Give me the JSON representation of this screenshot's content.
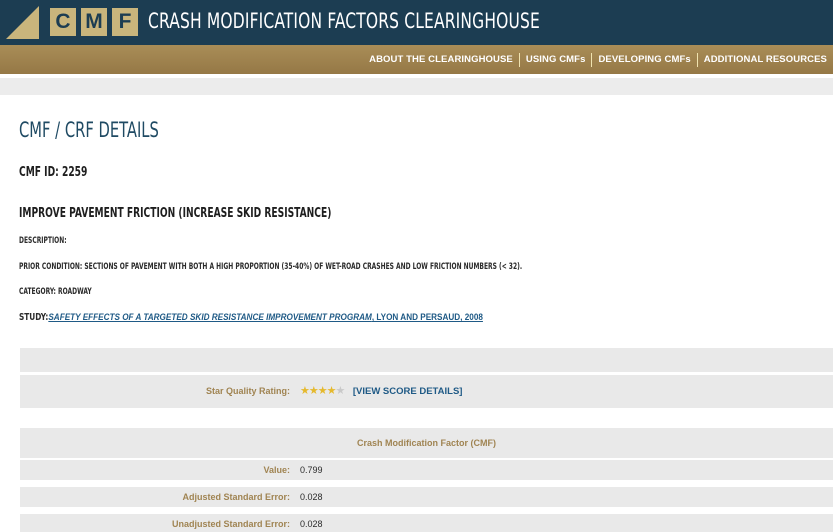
{
  "header": {
    "logo_letters": [
      "C",
      "M",
      "F"
    ],
    "site_title": "CRASH MODIFICATION FACTORS CLEARINGHOUSE",
    "brand_colors": {
      "navy": "#1c3d52",
      "gold": "#c9b57c"
    }
  },
  "nav": {
    "items": [
      {
        "label": "ABOUT THE CLEARINGHOUSE"
      },
      {
        "label": "USING CMFs"
      },
      {
        "label": "DEVELOPING CMFs"
      },
      {
        "label": "ADDITIONAL RESOURCES"
      }
    ]
  },
  "page": {
    "title": "CMF / CRF DETAILS",
    "cmf_id": "CMF ID: 2259",
    "countermeasure": "IMPROVE PAVEMENT FRICTION (INCREASE SKID RESISTANCE)",
    "description": "DESCRIPTION:",
    "prior_condition": "PRIOR CONDITION: SECTIONS OF PAVEMENT WITH BOTH A HIGH PROPORTION (35-40%) OF WET-ROAD CRASHES AND LOW FRICTION NUMBERS (< 32).",
    "category": "CATEGORY: ROADWAY",
    "study_label": "STUDY:",
    "study_title": "SAFETY EFFECTS OF A TARGETED SKID RESISTANCE IMPROVEMENT PROGRAM",
    "study_authors": ", LYON AND PERSAUD, 2008"
  },
  "rating": {
    "label": "Star Quality Rating:",
    "stars_filled": 4,
    "stars_total": 5,
    "view_score_label": "[VIEW SCORE DETAILS]"
  },
  "cmf_table": {
    "heading": "Crash Modification Factor (CMF)",
    "rows": [
      {
        "label": "Value:",
        "value": "0.799"
      },
      {
        "label": "Adjusted Standard Error:",
        "value": "0.028"
      },
      {
        "label": "Unadjusted Standard Error:",
        "value": "0.028"
      }
    ]
  }
}
